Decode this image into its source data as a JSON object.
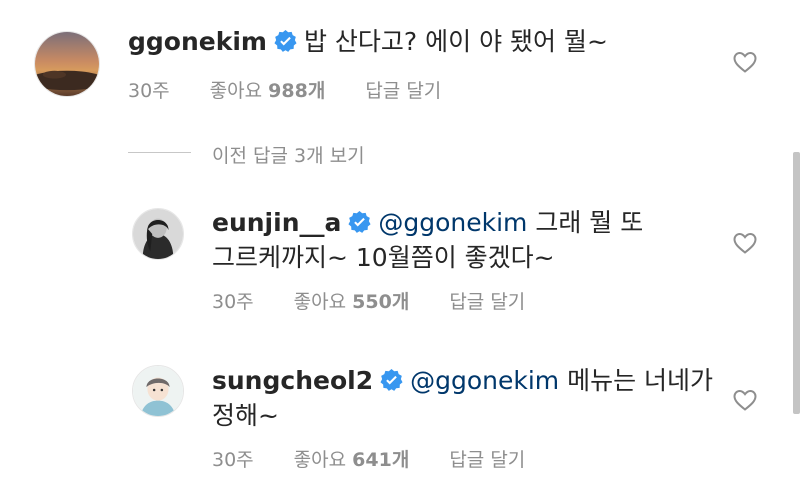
{
  "comments": [
    {
      "username": "ggonekim",
      "text": "밥 산다고? 에이 야 됐어 뭘~",
      "time": "30주",
      "likes_label": "좋아요",
      "likes_count": "988개",
      "reply_label": "답글 달기"
    }
  ],
  "view_previous": "이전 답글 3개 보기",
  "replies": [
    {
      "username": "eunjin__a",
      "mention": "@ggonekim",
      "text_line1": "그래 뭘 또",
      "text_line2": "그르케까지~ 10월쯤이 좋겠다~",
      "time": "30주",
      "likes_label": "좋아요",
      "likes_count": "550개",
      "reply_label": "답글 달기"
    },
    {
      "username": "sungcheol2",
      "mention": "@ggonekim",
      "text_line1": "메뉴는 너네가",
      "text_line2": "정해~",
      "time": "30주",
      "likes_label": "좋아요",
      "likes_count": "641개",
      "reply_label": "답글 달기"
    }
  ],
  "colors": {
    "text": "#262626",
    "meta": "#8e8e8e",
    "mention": "#00376b",
    "verified": "#3897f0"
  },
  "icons": [
    "verified-icon",
    "heart-icon"
  ]
}
